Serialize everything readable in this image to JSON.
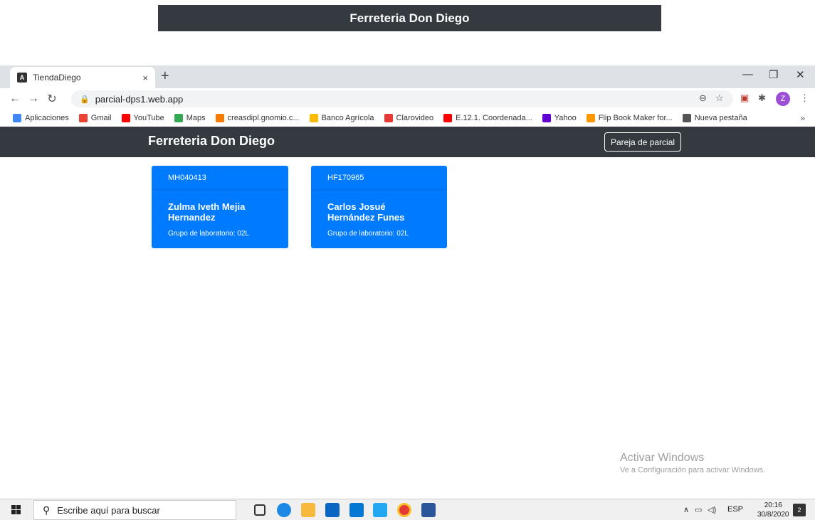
{
  "banner": {
    "title": "Ferreteria Don Diego"
  },
  "browser": {
    "tab_title": "TiendaDiego",
    "tab_close": "×",
    "new_tab": "+",
    "url": "parcial-dps1.web.app",
    "avatar_letter": "Z",
    "bookmarks": [
      {
        "label": "Aplicaciones",
        "color": "#4285f4"
      },
      {
        "label": "Gmail",
        "color": "#ea4335"
      },
      {
        "label": "YouTube",
        "color": "#ff0000"
      },
      {
        "label": "Maps",
        "color": "#34a853"
      },
      {
        "label": "creasdipl.gnomio.c...",
        "color": "#f57c00"
      },
      {
        "label": "Banco Agrícola",
        "color": "#fbbc05"
      },
      {
        "label": "Clarovideo",
        "color": "#e53935"
      },
      {
        "label": "E.12.1. Coordenada...",
        "color": "#ff0000"
      },
      {
        "label": "Yahoo",
        "color": "#6001d2"
      },
      {
        "label": "Flip Book Maker for...",
        "color": "#ff9800"
      },
      {
        "label": "Nueva pestaña",
        "color": "#555555"
      }
    ],
    "bookmarks_more": "»"
  },
  "app": {
    "brand": "Ferreteria Don Diego",
    "nav_button": "Pareja de parcial",
    "cards": [
      {
        "id": "MH040413",
        "name": "Zulma Iveth Mejia Hernandez",
        "group": "Grupo de laboratorio: 02L"
      },
      {
        "id": "HF170965",
        "name": "Carlos Josué Hernández Funes",
        "group": "Grupo de laboratorio: 02L"
      }
    ]
  },
  "watermark": {
    "title": "Activar Windows",
    "subtitle": "Ve a Configuración para activar Windows."
  },
  "taskbar": {
    "search_placeholder": "Escribe aquí para buscar",
    "language": "ESP",
    "time": "20:16",
    "date": "30/8/2020",
    "notifications": "2"
  },
  "colors": {
    "navbar": "#343a40",
    "card": "#007bff"
  }
}
